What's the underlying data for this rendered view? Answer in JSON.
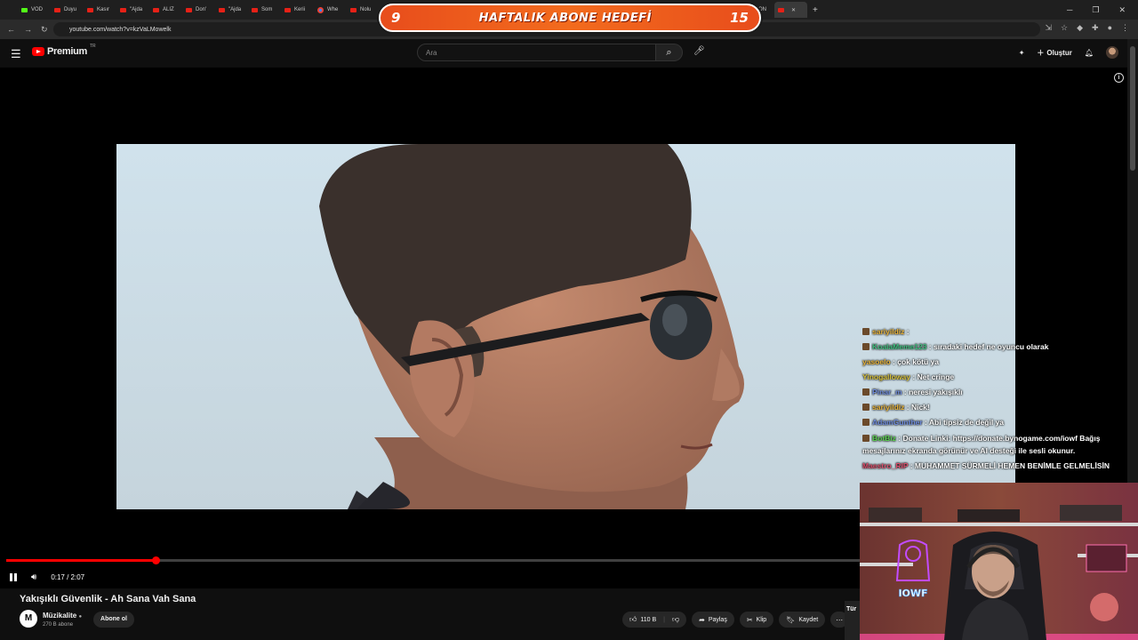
{
  "browser": {
    "tabs": [
      {
        "label": "VOD",
        "fav": "green"
      },
      {
        "label": "Duyu",
        "fav": "yt"
      },
      {
        "label": "Kasır",
        "fav": "yt"
      },
      {
        "label": "\"Ajda",
        "fav": "yt"
      },
      {
        "label": "ALIZ",
        "fav": "yt"
      },
      {
        "label": "Don'",
        "fav": "yt"
      },
      {
        "label": "\"Ajda",
        "fav": "yt"
      },
      {
        "label": "Som",
        "fav": "yt"
      },
      {
        "label": "Kerii",
        "fav": "yt"
      },
      {
        "label": "Whe",
        "fav": "chrome"
      },
      {
        "label": "Nolu",
        "fav": "yt"
      },
      {
        "label": "Som",
        "fav": "yt"
      },
      {
        "label": "Çılgı",
        "fav": "yt"
      },
      {
        "label": "ALIZ",
        "fav": "yt"
      },
      {
        "label": "Nolu",
        "fav": "yt"
      },
      {
        "label": "Nolu",
        "fav": "yt"
      },
      {
        "label": "Pupç",
        "fav": "yt"
      },
      {
        "label": "Geriı",
        "fav": "yt"
      },
      {
        "label": "Yakış",
        "fav": "yt"
      },
      {
        "label": "Ayşe",
        "fav": "yt"
      },
      {
        "label": "Geriı",
        "fav": "yt"
      },
      {
        "label": "Esra",
        "fav": "yt"
      },
      {
        "label": "KON",
        "fav": "yt"
      },
      {
        "label": "",
        "fav": "yt",
        "active": true
      }
    ],
    "url": "youtube.com/watch?v=kzVaLMowelk"
  },
  "goal": {
    "current": "9",
    "title": "HAFTALIK ABONE HEDEFİ",
    "target": "15",
    "progress_fraction": 0.6
  },
  "youtube": {
    "logo_text": "Premium",
    "logo_country": "TR",
    "search_placeholder": "Ara",
    "create_label": "Oluştur"
  },
  "player": {
    "time": "0:17 / 2:07",
    "progress_fraction": 0.134
  },
  "video": {
    "title": "Yakışıklı Güvenlik - Ah Sana Vah Sana",
    "channel": "Müzikalite",
    "channel_initial": "M",
    "subscribers": "270 B abone",
    "subscribe_label": "Abone ol",
    "likes": "110 B",
    "share_label": "Paylaş",
    "clip_label": "Klip",
    "save_label": "Kaydet"
  },
  "chat": [
    {
      "user": "sariyildiz",
      "color": "#e8b339",
      "text": ":",
      "badge": true
    },
    {
      "user": "KoalaMeme123",
      "color": "#3fbf7f",
      "text": ": sıradaki hedef ne oyuncu olarak",
      "badge": true
    },
    {
      "user": "yasoelo",
      "color": "#e8b339",
      "text": ": çok kötü ya",
      "badge": false
    },
    {
      "user": "Yinogalloway",
      "color": "#d8c13a",
      "text": ": Net cringe",
      "badge": false
    },
    {
      "user": "Pinar_m",
      "color": "#6f8dde",
      "text": ": neresi yakışıklı",
      "badge": true
    },
    {
      "user": "sariyildiz",
      "color": "#e8b339",
      "text": ": Nick!",
      "badge": true
    },
    {
      "user": "AdamGunther",
      "color": "#6f8dde",
      "text": ": Abi tipsiz de değil ya",
      "badge": true
    },
    {
      "user": "BotBiz",
      "color": "#5ad14f",
      "text": ": Donate Linki: https://donate.bynogame.com/iowf Bağış mesajlarınız ekranda görünür ve AI desteği ile sesli okunur.",
      "badge": true,
      "wrap": true
    },
    {
      "user": "Maestro_RIP",
      "color": "#d94d6a",
      "text": ": MUHAMMET SÜRMELİ HEMEN BENİMLE GELMELİSİN",
      "badge": false
    }
  ],
  "webcam": {
    "neon_sign": "IOWF",
    "side_label": "Tür"
  },
  "colors": {
    "accent": "#ff0000",
    "bg": "#0f0f0f",
    "goal_orange": "#f26b1d"
  }
}
